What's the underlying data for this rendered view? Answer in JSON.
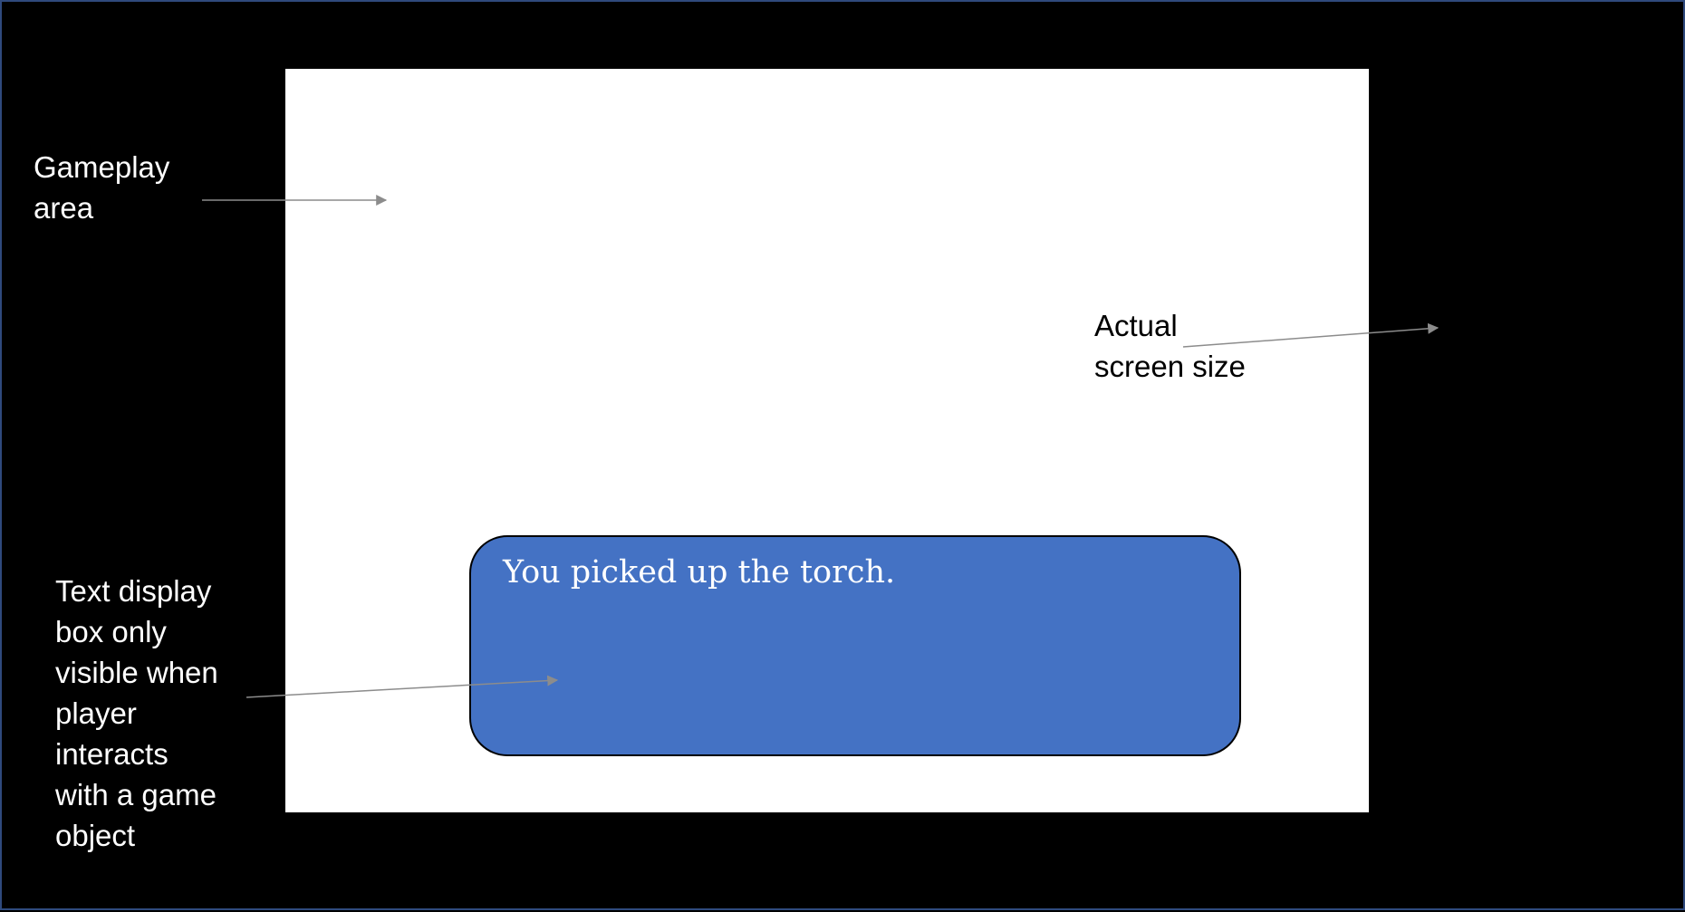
{
  "diagram": {
    "colors": {
      "background": "#000000",
      "gameplay_area": "#ffffff",
      "text_box": "#4472c4",
      "arrow": "#8c8c8c"
    },
    "labels": {
      "gameplay_area": [
        "Gameplay",
        "area"
      ],
      "actual_screen_size": [
        "Actual",
        "screen size"
      ],
      "text_display_box": [
        "Text display",
        "box only",
        "visible when",
        "player",
        "interacts",
        "with a game",
        "object"
      ]
    },
    "text_box": {
      "message": "You picked up the torch."
    }
  }
}
